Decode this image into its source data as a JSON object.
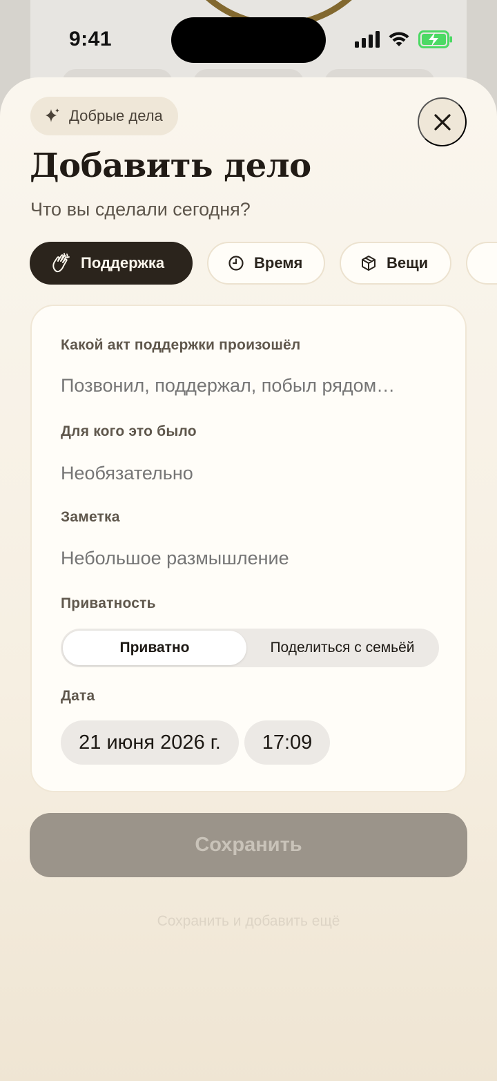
{
  "status_bar": {
    "time": "9:41"
  },
  "sheet": {
    "tag": {
      "label": "Добрые дела",
      "icon": "sparkles-icon"
    },
    "close_icon": "close-icon",
    "title": "Добавить дело",
    "subtitle": "Что вы сделали сегодня?"
  },
  "categories": [
    {
      "label": "Поддержка",
      "icon": "clapping-hands-icon",
      "selected": true
    },
    {
      "label": "Время",
      "icon": "clock-icon",
      "selected": false
    },
    {
      "label": "Вещи",
      "icon": "box-icon",
      "selected": false
    }
  ],
  "form": {
    "act": {
      "label": "Какой акт поддержки произошёл",
      "value": "",
      "placeholder": "Позвонил, поддержал, побыл рядом…"
    },
    "recipient": {
      "label": "Для кого это было",
      "value": "",
      "placeholder": "Необязательно"
    },
    "note": {
      "label": "Заметка",
      "value": "",
      "placeholder": "Небольшое размышление"
    },
    "privacy": {
      "label": "Приватность",
      "options": [
        "Приватно",
        "Поделиться с семьёй"
      ],
      "selected": "Приватно"
    },
    "date": {
      "label": "Дата",
      "date_value": "21 июня 2026 г.",
      "time_value": "17:09"
    }
  },
  "actions": {
    "save_label": "Сохранить",
    "save_more_label": "Сохранить и добавить ещё"
  },
  "colors": {
    "accent_dark": "#2b241c",
    "sheet_bg": "#faf6ee",
    "save_disabled": "#9b948a",
    "battery_green": "#4cd964"
  }
}
